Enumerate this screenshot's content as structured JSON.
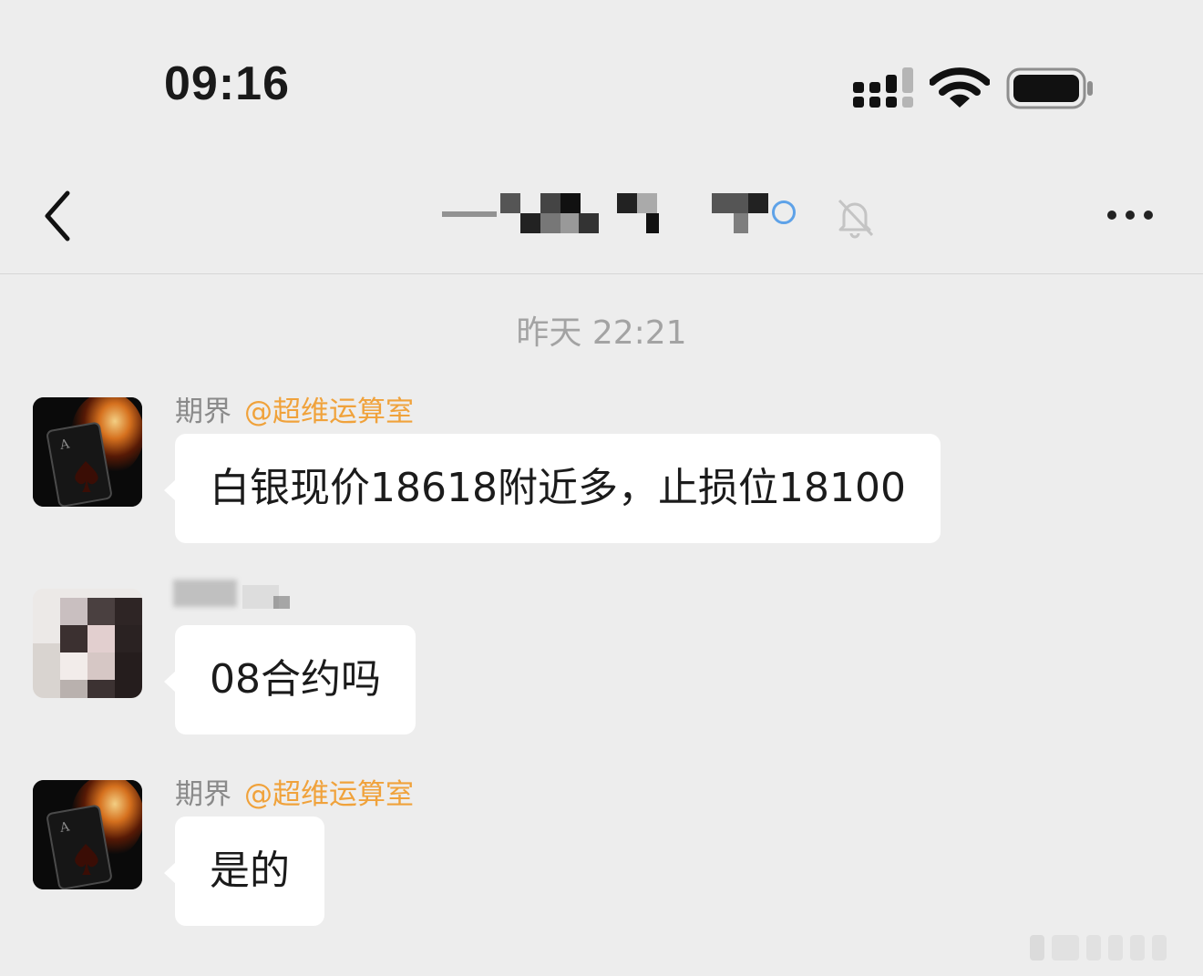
{
  "status_bar": {
    "time": "09:16",
    "icons": [
      "cellular-signal-icon",
      "wifi-icon",
      "battery-icon"
    ]
  },
  "nav": {
    "back_icon": "chevron-left-icon",
    "title": "",
    "mute_icon": "bell-slash-icon",
    "more_icon": "more-dots-icon"
  },
  "timestamp": "昨天 22:21",
  "messages": [
    {
      "sender": "期界",
      "mention": "@超维运算室",
      "text": "白银现价18618附近多，止损位18100",
      "avatar": "flaming-ace-of-spades-avatar"
    },
    {
      "sender": "",
      "mention": "",
      "text": "08合约吗",
      "avatar": "pixelated-user-avatar"
    },
    {
      "sender": "期界",
      "mention": "@超维运算室",
      "text": "是的",
      "avatar": "flaming-ace-of-spades-avatar"
    }
  ],
  "colors": {
    "background": "#ededed",
    "bubble": "#ffffff",
    "mention": "#f0a23b",
    "timestamp": "#a3a3a3"
  }
}
